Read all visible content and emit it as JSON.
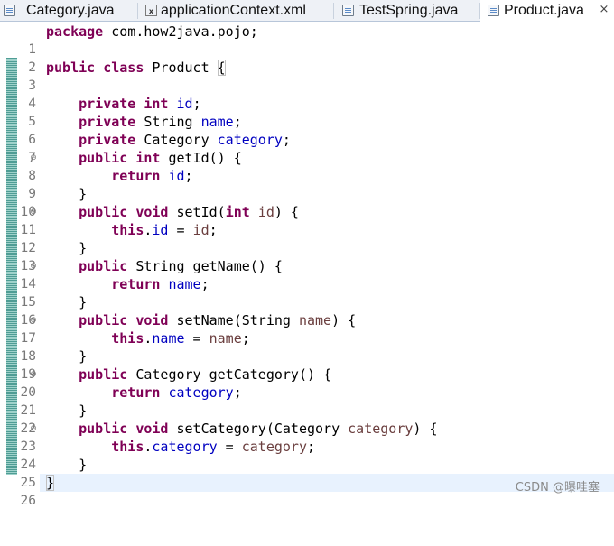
{
  "tabs": [
    {
      "label": "Category.java",
      "icon": "java-file-icon",
      "active": false
    },
    {
      "label": "applicationContext.xml",
      "icon": "xml-file-icon",
      "active": false
    },
    {
      "label": "TestSpring.java",
      "icon": "java-file-icon",
      "active": false
    },
    {
      "label": "Product.java",
      "icon": "java-file-icon",
      "active": true,
      "close": "×"
    }
  ],
  "editor": {
    "current_line": 26,
    "lines": [
      {
        "n": "1",
        "fold": ""
      },
      {
        "n": "2",
        "fold": ""
      },
      {
        "n": "3",
        "fold": ""
      },
      {
        "n": "4",
        "fold": ""
      },
      {
        "n": "5",
        "fold": ""
      },
      {
        "n": "6",
        "fold": ""
      },
      {
        "n": "7",
        "fold": ""
      },
      {
        "n": "8",
        "fold": "⊖"
      },
      {
        "n": "9",
        "fold": ""
      },
      {
        "n": "10",
        "fold": ""
      },
      {
        "n": "11",
        "fold": "⊖"
      },
      {
        "n": "12",
        "fold": ""
      },
      {
        "n": "13",
        "fold": ""
      },
      {
        "n": "14",
        "fold": "⊖"
      },
      {
        "n": "15",
        "fold": ""
      },
      {
        "n": "16",
        "fold": ""
      },
      {
        "n": "17",
        "fold": "⊖"
      },
      {
        "n": "18",
        "fold": ""
      },
      {
        "n": "19",
        "fold": ""
      },
      {
        "n": "20",
        "fold": "⊖"
      },
      {
        "n": "21",
        "fold": ""
      },
      {
        "n": "22",
        "fold": ""
      },
      {
        "n": "23",
        "fold": "⊖"
      },
      {
        "n": "24",
        "fold": ""
      },
      {
        "n": "25",
        "fold": ""
      },
      {
        "n": "26",
        "fold": ""
      }
    ],
    "tokens": {
      "l1_kw": "package",
      "l1_rest": " com.how2java.pojo;",
      "l3_kw": "public class",
      "l3_rest": " Product ",
      "l3_brace": "{",
      "l5_kw": "private int",
      "l5_fld": "id",
      "l5_end": ";",
      "l6_kw": "private",
      "l6_type": " String ",
      "l6_fld": "name",
      "l6_end": ";",
      "l7_kw": "private",
      "l7_type": " Category ",
      "l7_fld": "category",
      "l7_end": ";",
      "l8_kw": "public int",
      "l8_rest": " getId() {",
      "l9_kw": "return",
      "l9_fld": "id",
      "l9_end": ";",
      "l10": "}",
      "l11_kw": "public void",
      "l11_rest": " setId(",
      "l11_kw2": "int",
      "l11_prm": "id",
      "l11_end": ") {",
      "l12_kw": "this",
      "l12_dot": ".",
      "l12_fld": "id",
      "l12_eq": " = ",
      "l12_prm": "id",
      "l12_end": ";",
      "l13": "}",
      "l14_kw": "public",
      "l14_rest": " String getName() {",
      "l15_kw": "return",
      "l15_fld": "name",
      "l15_end": ";",
      "l16": "}",
      "l17_kw": "public void",
      "l17_rest": " setName(String ",
      "l17_prm": "name",
      "l17_end": ") {",
      "l18_kw": "this",
      "l18_dot": ".",
      "l18_fld": "name",
      "l18_eq": " = ",
      "l18_prm": "name",
      "l18_end": ";",
      "l19": "}",
      "l20_kw": "public",
      "l20_rest": " Category getCategory() {",
      "l21_kw": "return",
      "l21_fld": "category",
      "l21_end": ";",
      "l22": "}",
      "l23_kw": "public void",
      "l23_rest": " setCategory(Category ",
      "l23_prm": "category",
      "l23_end": ") {",
      "l24_kw": "this",
      "l24_dot": ".",
      "l24_fld": "category",
      "l24_eq": " = ",
      "l24_prm": "category",
      "l24_end": ";",
      "l25": "}",
      "l26": "}"
    }
  },
  "watermark": "CSDN @曝哇塞",
  "colors": {
    "keyword": "#7f0055",
    "field": "#0000c0",
    "parameter": "#6a3e3e",
    "current_line": "#e8f2fe",
    "ruler": "#5fa8a0"
  }
}
